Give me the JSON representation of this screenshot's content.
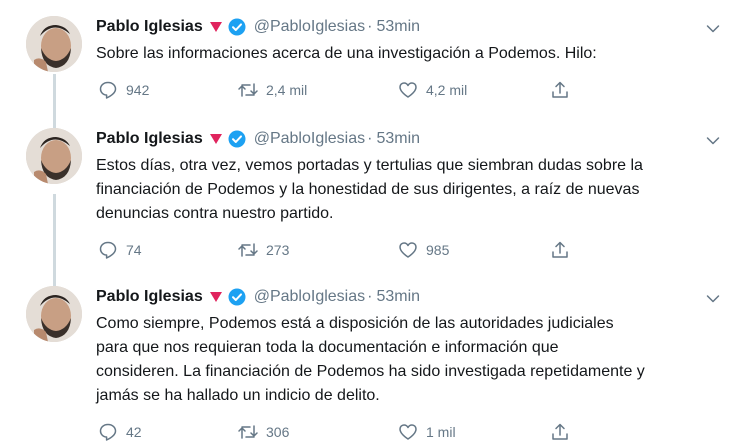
{
  "tweets": [
    {
      "name": "Pablo Iglesias",
      "handle": "@PabloIglesias",
      "separator": "·",
      "time": "53min",
      "text": "Sobre las informaciones acerca de una investigación a Podemos. Hilo:",
      "replies": "942",
      "retweets": "2,4 mil",
      "likes": "4,2 mil"
    },
    {
      "name": "Pablo Iglesias",
      "handle": "@PabloIglesias",
      "separator": "·",
      "time": "53min",
      "text": "Estos días, otra vez, vemos portadas y tertulias que siembran dudas sobre la\nfinanciación de Podemos y la honestidad de sus dirigentes, a raíz de nuevas\ndenuncias contra nuestro partido.",
      "replies": "74",
      "retweets": "273",
      "likes": "985"
    },
    {
      "name": "Pablo Iglesias",
      "handle": "@PabloIglesias",
      "separator": "·",
      "time": "53min",
      "text": "Como siempre, Podemos está a disposición de las autoridades judiciales\npara que nos requieran toda la documentación e información que\nconsideren. La financiación de Podemos ha sido investigada repetidamente y\njamás se ha hallado un indicio de delito.",
      "replies": "42",
      "retweets": "306",
      "likes": "1 mil"
    }
  ],
  "colors": {
    "text": "#14171a",
    "muted": "#657786",
    "verified": "#1da1f2",
    "heart_emoji": "#e0245e",
    "thread_line": "#cfd9de"
  },
  "icons": [
    "reply-icon",
    "retweet-icon",
    "like-icon",
    "share-icon",
    "verified-icon",
    "chevron-down-icon",
    "heart-emoji-icon"
  ]
}
